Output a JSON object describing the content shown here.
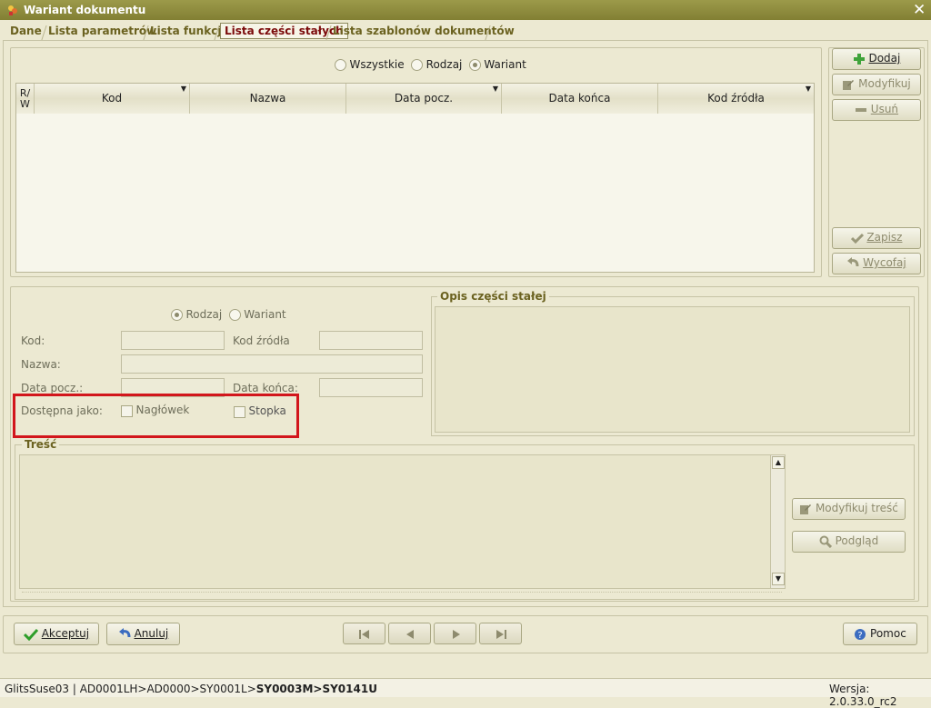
{
  "window": {
    "title": "Wariant dokumentu"
  },
  "tabs": [
    {
      "label": "Dane"
    },
    {
      "label": "Lista parametrów"
    },
    {
      "label": "Lista funkcji"
    },
    {
      "label": "Lista części stałych"
    },
    {
      "label": "Lista szablonów dokumentów"
    }
  ],
  "filter": {
    "all": "Wszystkie",
    "kind": "Rodzaj",
    "variant": "Wariant",
    "selected": "Wariant"
  },
  "grid": {
    "rw_line1": "R/",
    "rw_line2": "W",
    "columns": [
      "Kod",
      "Nazwa",
      "Data pocz.",
      "Data końca",
      "Kod źródła"
    ]
  },
  "side_buttons": {
    "add": "Dodaj",
    "modify": "Modyfikuj",
    "delete": "Usuń",
    "save": "Zapisz",
    "revert": "Wycofaj"
  },
  "form": {
    "radio_kind": "Rodzaj",
    "radio_variant": "Wariant",
    "selected": "Rodzaj",
    "code_label": "Kod:",
    "source_code_label": "Kod źródła",
    "name_label": "Nazwa:",
    "start_date_label": "Data pocz.:",
    "end_date_label": "Data końca:",
    "available_as_label": "Dostępna jako:",
    "header_label": "Nagłówek",
    "footer_label": "Stopka",
    "description_title": "Opis części stałej",
    "content_title": "Treść"
  },
  "content_buttons": {
    "modify_content": "Modyfikuj treść",
    "preview": "Podgląd"
  },
  "footer": {
    "accept": "Akceptuj",
    "cancel": "Anuluj",
    "help": "Pomoc"
  },
  "status": {
    "path_prefix": "GlitsSuse03 | AD0001LH>AD0000>SY0001L>",
    "path_bold": "SY0003M>SY0141U",
    "version": "Wersja: 2.0.33.0_rc2"
  },
  "colors": {
    "accent_title": "#7B0A0A",
    "tab_text": "#6B6220",
    "highlight_box": "#D2161C",
    "add_icon": "#3FA33A",
    "accept_icon": "#2E9E2A"
  }
}
